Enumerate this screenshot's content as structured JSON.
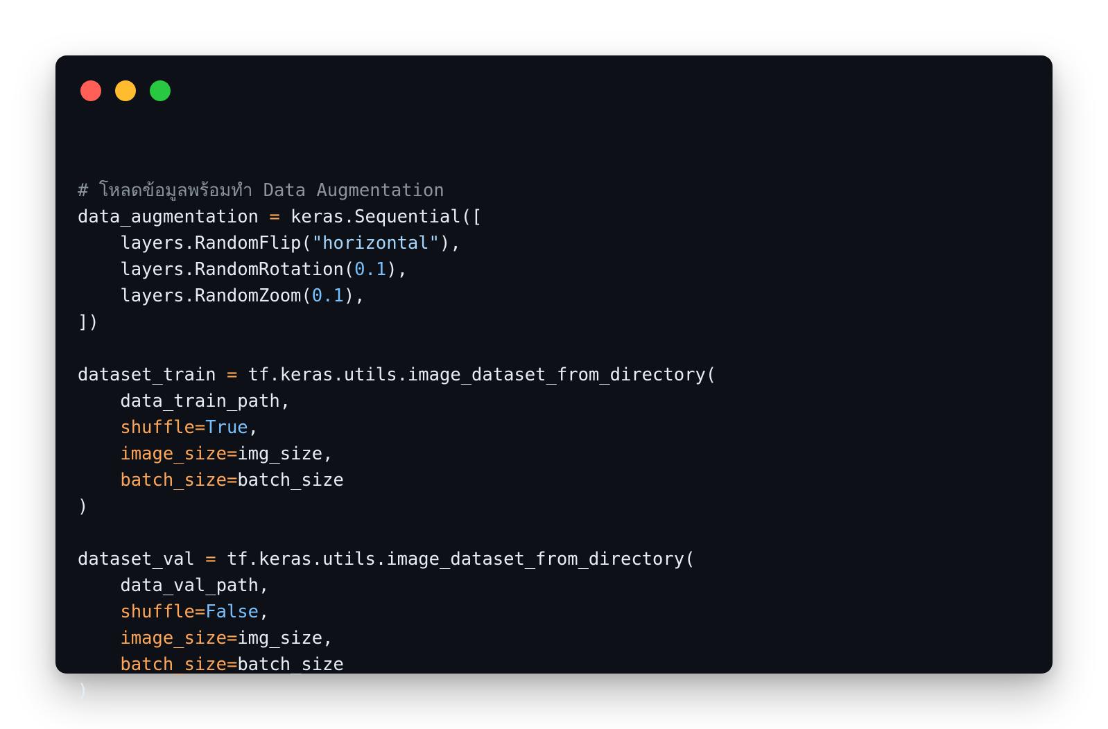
{
  "window": {
    "background": "#0d1117",
    "controls": {
      "close_color": "#ff5f57",
      "minimize_color": "#febc2e",
      "maximize_color": "#28c840"
    }
  },
  "code": {
    "language": "python",
    "lines": [
      [
        {
          "t": "# โหลดข้อมูลพร้อมทำ Data Augmentation",
          "k": "comment"
        }
      ],
      [
        {
          "t": "data_augmentation ",
          "k": "plain"
        },
        {
          "t": "=",
          "k": "op"
        },
        {
          "t": " keras.Sequential([",
          "k": "plain"
        }
      ],
      [
        {
          "t": "    layers.RandomFlip(",
          "k": "plain"
        },
        {
          "t": "\"horizontal\"",
          "k": "str"
        },
        {
          "t": "),",
          "k": "plain"
        }
      ],
      [
        {
          "t": "    layers.RandomRotation(",
          "k": "plain"
        },
        {
          "t": "0.1",
          "k": "num"
        },
        {
          "t": "),",
          "k": "plain"
        }
      ],
      [
        {
          "t": "    layers.RandomZoom(",
          "k": "plain"
        },
        {
          "t": "0.1",
          "k": "num"
        },
        {
          "t": "),",
          "k": "plain"
        }
      ],
      [
        {
          "t": "])",
          "k": "plain"
        }
      ],
      [],
      [
        {
          "t": "dataset_train ",
          "k": "plain"
        },
        {
          "t": "=",
          "k": "op"
        },
        {
          "t": " tf.keras.utils.image_dataset_from_directory(",
          "k": "plain"
        }
      ],
      [
        {
          "t": "    data_train_path,",
          "k": "plain"
        }
      ],
      [
        {
          "t": "    ",
          "k": "plain"
        },
        {
          "t": "shuffle=",
          "k": "param"
        },
        {
          "t": "True",
          "k": "kw"
        },
        {
          "t": ",",
          "k": "plain"
        }
      ],
      [
        {
          "t": "    ",
          "k": "plain"
        },
        {
          "t": "image_size=",
          "k": "param"
        },
        {
          "t": "img_size,",
          "k": "plain"
        }
      ],
      [
        {
          "t": "    ",
          "k": "plain"
        },
        {
          "t": "batch_size=",
          "k": "param"
        },
        {
          "t": "batch_size",
          "k": "plain"
        }
      ],
      [
        {
          "t": ")",
          "k": "plain"
        }
      ],
      [],
      [
        {
          "t": "dataset_val ",
          "k": "plain"
        },
        {
          "t": "=",
          "k": "op"
        },
        {
          "t": " tf.keras.utils.image_dataset_from_directory(",
          "k": "plain"
        }
      ],
      [
        {
          "t": "    data_val_path,",
          "k": "plain"
        }
      ],
      [
        {
          "t": "    ",
          "k": "plain"
        },
        {
          "t": "shuffle=",
          "k": "param"
        },
        {
          "t": "False",
          "k": "kw"
        },
        {
          "t": ",",
          "k": "plain"
        }
      ],
      [
        {
          "t": "    ",
          "k": "plain"
        },
        {
          "t": "image_size=",
          "k": "param"
        },
        {
          "t": "img_size,",
          "k": "plain"
        }
      ],
      [
        {
          "t": "    ",
          "k": "plain"
        },
        {
          "t": "batch_size=",
          "k": "param"
        },
        {
          "t": "batch_size",
          "k": "plain"
        }
      ],
      [
        {
          "t": ")",
          "k": "plain"
        }
      ]
    ]
  }
}
